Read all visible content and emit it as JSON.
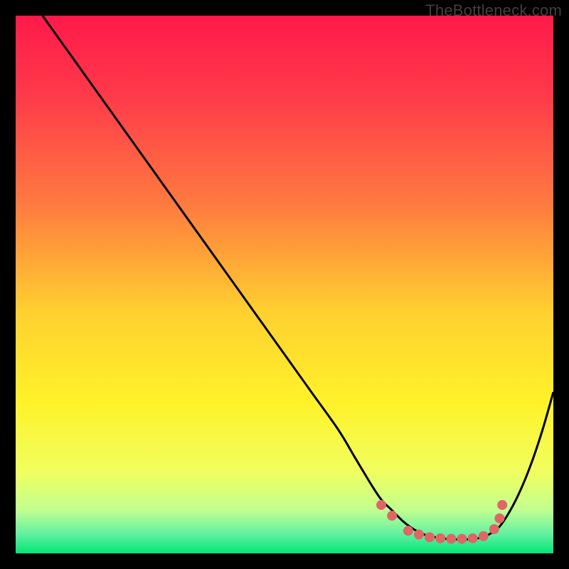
{
  "watermark": "TheBottleneck.com",
  "chart_data": {
    "type": "line",
    "title": "",
    "xlabel": "",
    "ylabel": "",
    "xlim": [
      0,
      100
    ],
    "ylim": [
      0,
      100
    ],
    "gradient_stops": [
      {
        "offset": 0.0,
        "color": "#ff1a4a"
      },
      {
        "offset": 0.15,
        "color": "#ff3a4a"
      },
      {
        "offset": 0.35,
        "color": "#ff7a40"
      },
      {
        "offset": 0.55,
        "color": "#ffd030"
      },
      {
        "offset": 0.72,
        "color": "#fff22a"
      },
      {
        "offset": 0.85,
        "color": "#f0ff60"
      },
      {
        "offset": 0.92,
        "color": "#c0ff90"
      },
      {
        "offset": 0.965,
        "color": "#60f0a0"
      },
      {
        "offset": 1.0,
        "color": "#00e676"
      }
    ],
    "curve": {
      "x": [
        5,
        10,
        15,
        20,
        25,
        30,
        35,
        40,
        45,
        50,
        55,
        60,
        63,
        66,
        68,
        70,
        72,
        74,
        76,
        78,
        80,
        82,
        84,
        86,
        88,
        90,
        92,
        94,
        96,
        98,
        100
      ],
      "y": [
        100,
        93,
        86,
        79,
        72,
        65,
        58,
        51,
        44,
        37,
        30,
        23,
        18,
        13,
        10,
        8,
        6,
        4.5,
        3.5,
        3,
        2.7,
        2.6,
        2.6,
        2.8,
        3.5,
        5,
        8,
        12,
        17,
        23,
        30
      ]
    },
    "dots": {
      "x": [
        68,
        70,
        73,
        75,
        77,
        79,
        81,
        83,
        85,
        87,
        89,
        90,
        90.5
      ],
      "y": [
        9,
        7,
        4.2,
        3.5,
        3.0,
        2.8,
        2.7,
        2.7,
        2.8,
        3.2,
        4.5,
        6.5,
        9
      ],
      "color": "#e06666",
      "radius_px": 7
    }
  }
}
